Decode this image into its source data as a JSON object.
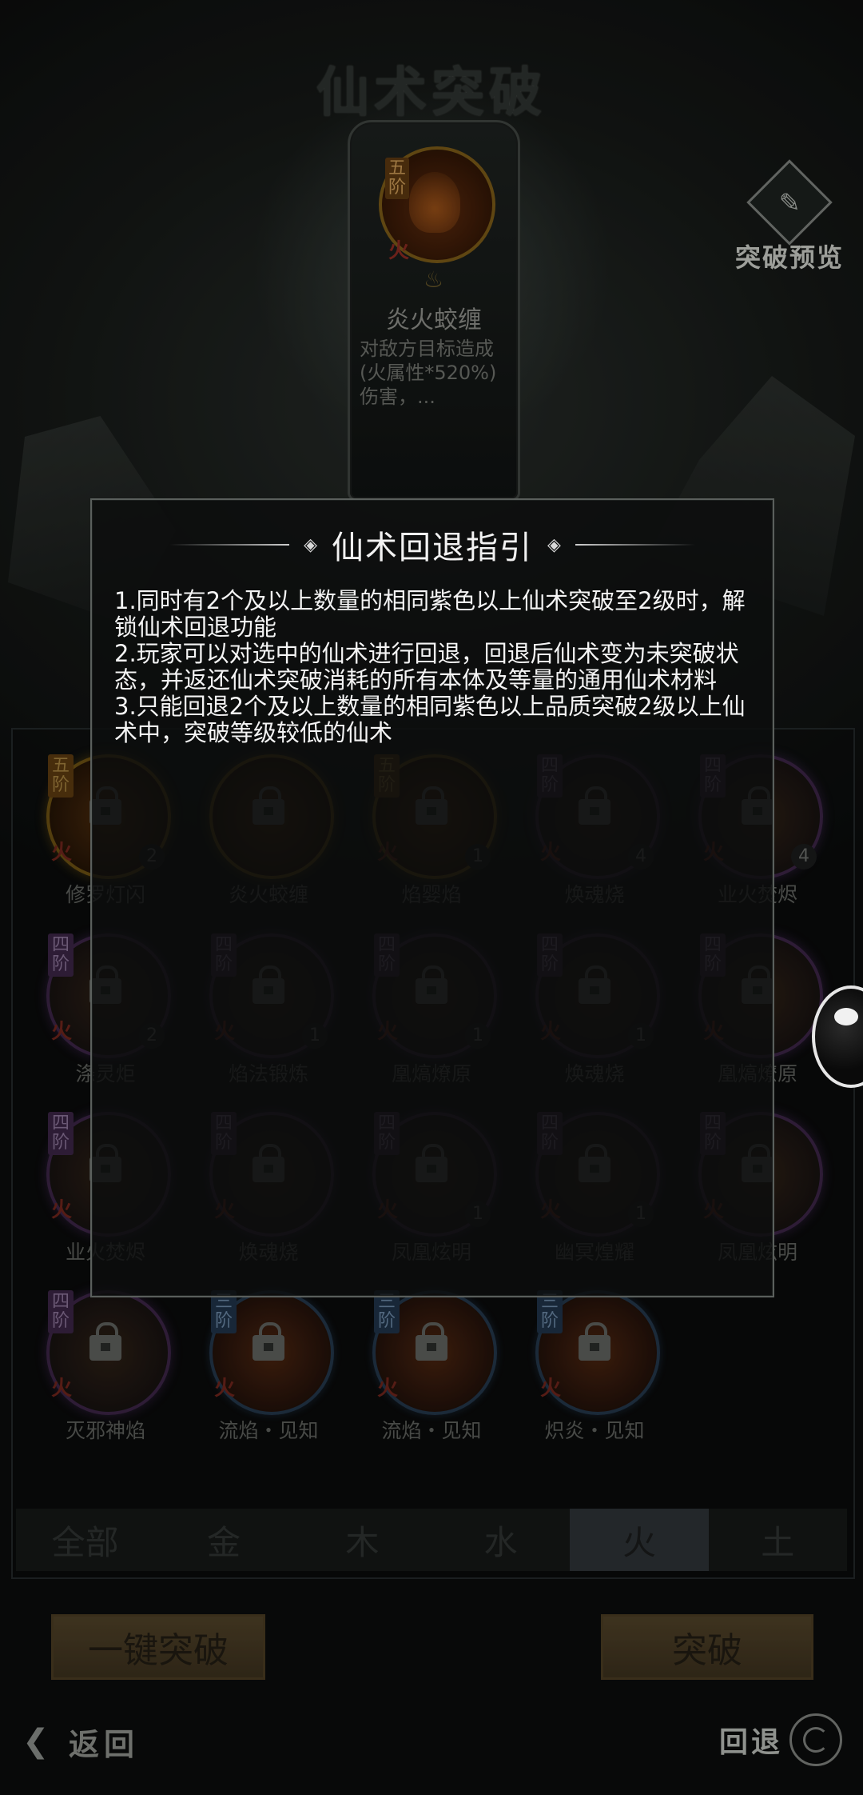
{
  "screen": {
    "title": "仙术突破",
    "preview_label": "突破预览"
  },
  "selected_spell": {
    "tier": "五阶",
    "element": "火",
    "name": "炎火蛟缠",
    "description": "对敌方目标造成　　　(火属性*520%)伤害，..."
  },
  "spells": [
    {
      "tier": "五阶",
      "element": "火",
      "count": "2",
      "name": "修罗灯闪",
      "quality": "gold"
    },
    {
      "tier": "",
      "element": "",
      "count": "",
      "name": "炎火蛟缠",
      "quality": "gold"
    },
    {
      "tier": "五阶",
      "element": "火",
      "count": "1",
      "name": "焰婴焰",
      "quality": "gold"
    },
    {
      "tier": "四阶",
      "element": "火",
      "count": "4",
      "name": "焕魂烧",
      "quality": "purple"
    },
    {
      "tier": "四阶",
      "element": "火",
      "count": "4",
      "name": "业火焚烬",
      "quality": "purple"
    },
    {
      "tier": "四阶",
      "element": "火",
      "count": "2",
      "name": "涤灵炬",
      "quality": "purple"
    },
    {
      "tier": "四阶",
      "element": "火",
      "count": "1",
      "name": "焰法锻炼",
      "quality": "purple"
    },
    {
      "tier": "四阶",
      "element": "火",
      "count": "1",
      "name": "凰熇燎原",
      "quality": "purple"
    },
    {
      "tier": "四阶",
      "element": "火",
      "count": "1",
      "name": "焕魂烧",
      "quality": "purple"
    },
    {
      "tier": "四阶",
      "element": "火",
      "count": "",
      "name": "凰熇燎原",
      "quality": "purple"
    },
    {
      "tier": "四阶",
      "element": "火",
      "count": "",
      "name": "业火焚烬",
      "quality": "purple"
    },
    {
      "tier": "四阶",
      "element": "火",
      "count": "",
      "name": "焕魂烧",
      "quality": "purple"
    },
    {
      "tier": "四阶",
      "element": "火",
      "count": "1",
      "name": "凤凰炫明",
      "quality": "purple"
    },
    {
      "tier": "四阶",
      "element": "火",
      "count": "1",
      "name": "幽冥煌耀",
      "quality": "purple"
    },
    {
      "tier": "四阶",
      "element": "火",
      "count": "",
      "name": "凤凰炫明",
      "quality": "purple"
    },
    {
      "tier": "四阶",
      "element": "火",
      "count": "",
      "name": "灭邪神焰",
      "quality": "purple"
    },
    {
      "tier": "三阶",
      "element": "火",
      "count": "",
      "name": "流焰・见知",
      "quality": "blue"
    },
    {
      "tier": "三阶",
      "element": "火",
      "count": "",
      "name": "流焰・见知",
      "quality": "blue"
    },
    {
      "tier": "三阶",
      "element": "火",
      "count": "",
      "name": "炽炎・见知",
      "quality": "blue"
    }
  ],
  "tabs": [
    {
      "label": "全部",
      "active": false
    },
    {
      "label": "金",
      "active": false
    },
    {
      "label": "木",
      "active": false
    },
    {
      "label": "水",
      "active": false
    },
    {
      "label": "火",
      "active": true
    },
    {
      "label": "土",
      "active": false
    }
  ],
  "actions": {
    "one_click": "一键突破",
    "breakthrough": "突破",
    "back": "返回",
    "rollback": "回退"
  },
  "dialog": {
    "title": "仙术回退指引",
    "rules": [
      "1.同时有2个及以上数量的相同紫色以上仙术突破至2级时，解锁仙术回退功能",
      "2.玩家可以对选中的仙术进行回退，回退后仙术变为未突破状态，并返还仙术突破消耗的所有本体及等量的通用仙术材料",
      "3.只能回退2个及以上数量的相同紫色以上品质突破2级以上仙术中，突破等级较低的仙术"
    ]
  },
  "colors": {
    "background": "#0c0e0d",
    "dialog_border": "#5a5f5c",
    "dialog_text": "#f4f4f4",
    "fire_element": "#8a2b22",
    "gold_frame": "#7a5a18",
    "purple_frame": "#3b2446",
    "blue_frame": "#23364a"
  },
  "icons": [
    "lock-icon",
    "swirl-icon",
    "back-arrow-icon",
    "flame-icon",
    "preview-scroll-icon"
  ]
}
